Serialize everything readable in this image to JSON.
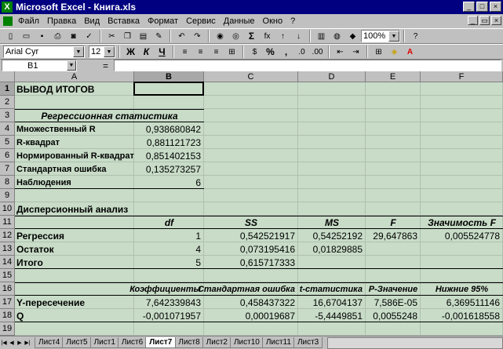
{
  "window": {
    "title": "Microsoft Excel - Книга.xls"
  },
  "menu": [
    "Файл",
    "Правка",
    "Вид",
    "Вставка",
    "Формат",
    "Сервис",
    "Данные",
    "Окно",
    "?"
  ],
  "toolbar": {
    "zoom": "100%",
    "font": "Arial Cyr",
    "size": "12",
    "bold": "Ж",
    "italic": "К",
    "underline": "Ч",
    "percent": "%",
    "sum": "Σ",
    "fx": "fx",
    "help": "?"
  },
  "formula": {
    "name_box": "B1",
    "eq": "=",
    "content": ""
  },
  "columns": [
    "A",
    "B",
    "C",
    "D",
    "E",
    "F"
  ],
  "rows": [
    "1",
    "2",
    "3",
    "4",
    "5",
    "6",
    "7",
    "8",
    "9",
    "10",
    "11",
    "12",
    "13",
    "14",
    "15",
    "16",
    "17",
    "18",
    "19"
  ],
  "cells": {
    "A1": "ВЫВОД ИТОГОВ",
    "A3": "Регрессионная статистика",
    "A4": "Множественный R",
    "B4": "0,938680842",
    "A5": "R-квадрат",
    "B5": "0,881121723",
    "A6": "Нормированный R-квадрат",
    "B6": "0,851402153",
    "A7": "Стандартная ошибка",
    "B7": "0,135273257",
    "A8": "Наблюдения",
    "B8": "6",
    "A10": "Дисперсионный анализ",
    "B11": "df",
    "C11": "SS",
    "D11": "MS",
    "E11": "F",
    "F11": "Значимость F",
    "A12": "Регрессия",
    "B12": "1",
    "C12": "0,542521917",
    "D12": "0,54252192",
    "E12": "29,647863",
    "F12": "0,005524778",
    "A13": "Остаток",
    "B13": "4",
    "C13": "0,073195416",
    "D13": "0,01829885",
    "A14": "Итого",
    "B14": "5",
    "C14": "0,615717333",
    "B16": "Коэффициенты",
    "C16": "Стандартная ошибка",
    "D16": "t-статистика",
    "E16": "P-Значение",
    "F16": "Нижние 95%",
    "A17": "Y-пересечение",
    "B17": "7,642339843",
    "C17": "0,458437322",
    "D17": "16,6704137",
    "E17": "7,586E-05",
    "F17": "6,369511146",
    "A18": "Q",
    "B18": "-0,001071957",
    "C18": "0,00019687",
    "D18": "-5,4449851",
    "E18": "0,0055248",
    "F18": "-0,001618558"
  },
  "sheets": [
    "Лист4",
    "Лист5",
    "Лист1",
    "Лист6",
    "Лист7",
    "Лист8",
    "Лист2",
    "Лист10",
    "Лист11",
    "Лист3"
  ],
  "active_sheet": "Лист7"
}
